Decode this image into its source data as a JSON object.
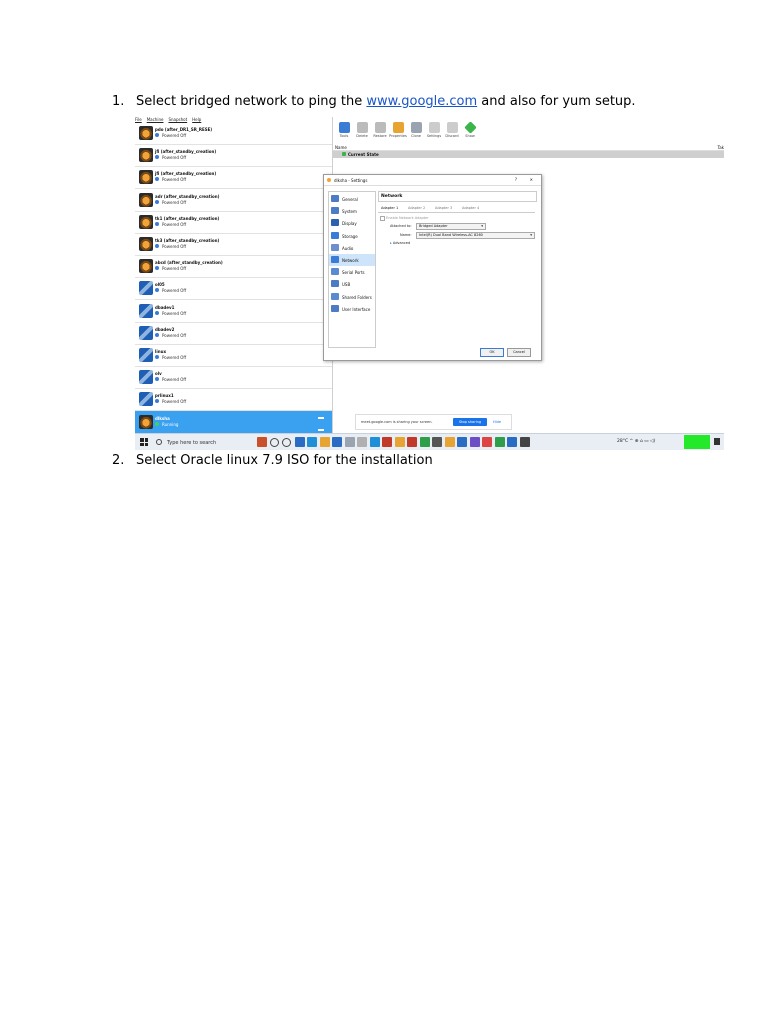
{
  "steps": [
    {
      "num": "1.",
      "pre": "Select bridged network to ping the ",
      "link": "www.google.com",
      "post": " and also for yum setup."
    },
    {
      "num": "2.",
      "text": "Select Oracle linux 7.9 ISO for the installation"
    }
  ],
  "screenshot": {
    "menubar": [
      "File",
      "Machine",
      "Snapshot",
      "Help"
    ],
    "vms": [
      {
        "name": "pdo (after_DR1_SR_RESE)",
        "status": "Powered Off",
        "icon": "oracle-linux"
      },
      {
        "name": "jfi (after_standby_creation)",
        "status": "Powered Off",
        "icon": "oracle-linux"
      },
      {
        "name": "jfi (after_standby_creation)",
        "status": "Powered Off",
        "icon": "oracle-linux"
      },
      {
        "name": "adr (after_standby_creation)",
        "status": "Powered Off",
        "icon": "oracle-linux"
      },
      {
        "name": "tk1 (after_standby_creation)",
        "status": "Powered Off",
        "icon": "oracle-linux"
      },
      {
        "name": "tk3 (after_standby_creation)",
        "status": "Powered Off",
        "icon": "oracle-linux"
      },
      {
        "name": "abcd (after_standby_creation)",
        "status": "Powered Off",
        "icon": "oracle-linux"
      },
      {
        "name": "ol05",
        "status": "Powered Off",
        "icon": "redhat"
      },
      {
        "name": "dbadev1",
        "status": "Powered Off",
        "icon": "redhat"
      },
      {
        "name": "dbadev2",
        "status": "Powered Off",
        "icon": "redhat"
      },
      {
        "name": "linux",
        "status": "Powered Off",
        "icon": "redhat"
      },
      {
        "name": "olv",
        "status": "Powered Off",
        "icon": "redhat"
      },
      {
        "name": "prlinux1",
        "status": "Powered Off",
        "icon": "redhat"
      },
      {
        "name": "dlksha",
        "status": "Running",
        "icon": "oracle-linux"
      }
    ],
    "toolbar": [
      "Tools",
      "Delete",
      "Restore",
      "Properties",
      "Clone",
      "Settings",
      "Discard",
      "Show"
    ],
    "name_header": "Name",
    "side_header": "Tak",
    "current_state": "Current State",
    "dialog": {
      "title": "dlksha - Settings",
      "help": "?",
      "close": "✕",
      "nav": [
        "General",
        "System",
        "Display",
        "Storage",
        "Audio",
        "Network",
        "Serial Ports",
        "USB",
        "Shared Folders",
        "User Interface"
      ],
      "active_nav": "Network",
      "header": "Network",
      "tabs": [
        "Adapter 1",
        "Adapter 2",
        "Adapter 3",
        "Adapter 4"
      ],
      "enable_label": "Enable Network Adapter",
      "attached_label": "Attached to:",
      "attached_value": "Bridged Adapter",
      "name_label": "Name:",
      "name_value": "Intel(R) Dual Band Wireless-AC 8260",
      "advanced_label": "Advanced",
      "ok": "OK",
      "cancel": "Cancel"
    },
    "sharebar": {
      "message": "meet.google.com is sharing your screen.",
      "stop": "Stop sharing",
      "hide": "Hide"
    },
    "taskbar": {
      "search_placeholder": "Type here to search",
      "tray": "28°C  ^  ⊕  ⌂  ▭  ◁)"
    }
  },
  "colors": {
    "link": "#1a55c8",
    "selected_vm": "#3aa0f0",
    "stop_sharing": "#1a73e8",
    "taskbar_green": "#24e82a"
  }
}
